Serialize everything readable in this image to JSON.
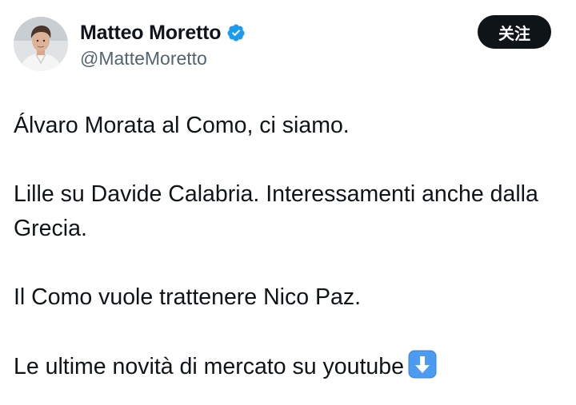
{
  "author": {
    "display_name": "Matteo Moretto",
    "handle": "@MatteMoretto",
    "verified": true,
    "avatar_icon": "profile-photo",
    "verified_icon": "verified-badge-icon",
    "verified_color": "#1d9bf0"
  },
  "follow_button": {
    "label": "关注"
  },
  "tweet": {
    "paragraphs": [
      "Álvaro Morata al Como, ci siamo.",
      "Lille su Davide Calabria. Interessamenti anche dalla Grecia.",
      "Il Como vuole trattenere Nico Paz.",
      "Le ultime novità di mercato su youtube"
    ],
    "trailing_emoji": "down-arrow-emoji"
  },
  "colors": {
    "text": "#0f1419",
    "secondary_text": "#536471",
    "button_bg": "#0f1419",
    "emoji_blue": "#4b9cf0"
  }
}
